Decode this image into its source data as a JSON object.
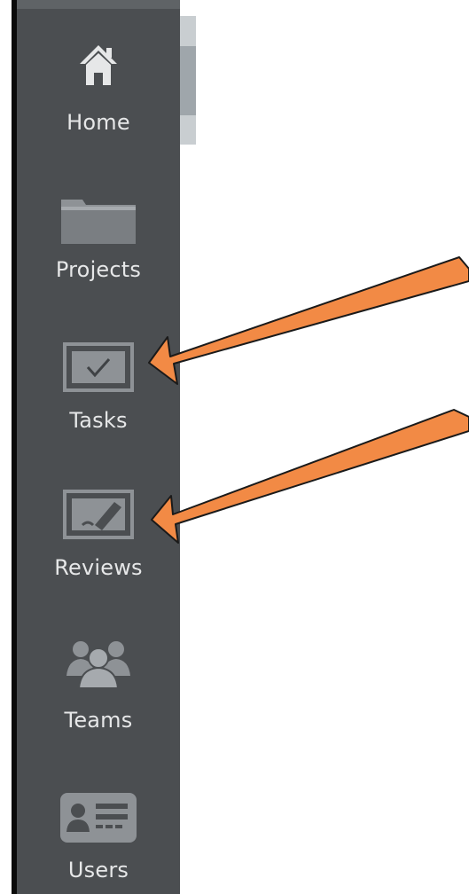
{
  "sidebar": {
    "items": [
      {
        "label": "Home",
        "icon": "home-icon"
      },
      {
        "label": "Projects",
        "icon": "folder-icon"
      },
      {
        "label": "Tasks",
        "icon": "checkbox-icon"
      },
      {
        "label": "Reviews",
        "icon": "review-icon"
      },
      {
        "label": "Teams",
        "icon": "team-icon"
      },
      {
        "label": "Users",
        "icon": "user-card-icon"
      }
    ]
  },
  "annotations": {
    "arrow_color": "#f28a45",
    "arrows": [
      {
        "target": "checkbox-icon"
      },
      {
        "target": "review-icon"
      }
    ]
  },
  "colors": {
    "sidebar_bg": "#4b4e51",
    "icon_color": "#e6e7e8",
    "icon_muted": "#8e9296"
  }
}
